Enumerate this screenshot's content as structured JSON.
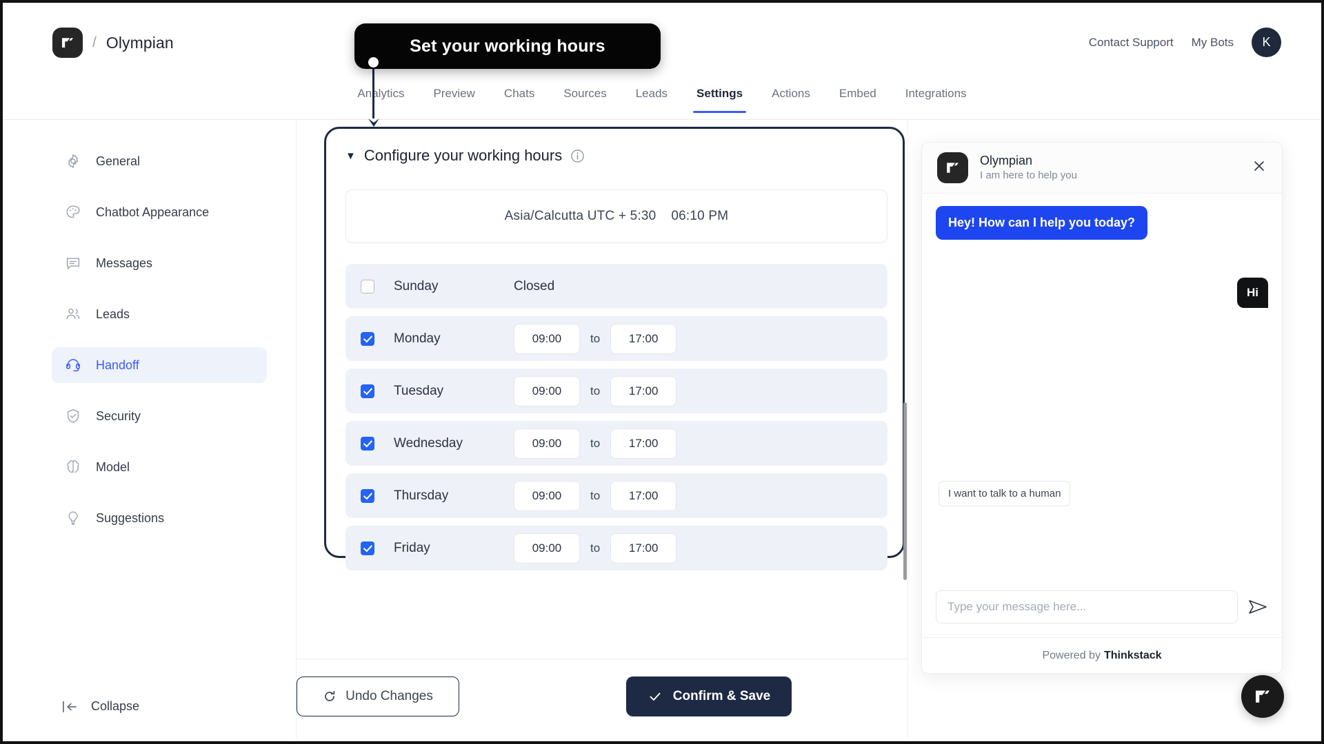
{
  "header": {
    "brand_name": "Olympian",
    "separator": "/",
    "logo_icon": "thinkstack-logo-icon",
    "contact_support": "Contact Support",
    "my_bots": "My Bots",
    "avatar_initial": "K",
    "avatar_color": "#1e293b"
  },
  "tabs": [
    {
      "label": "Analytics",
      "active": false
    },
    {
      "label": "Preview",
      "active": false
    },
    {
      "label": "Chats",
      "active": false
    },
    {
      "label": "Sources",
      "active": false
    },
    {
      "label": "Leads",
      "active": false
    },
    {
      "label": "Settings",
      "active": true
    },
    {
      "label": "Actions",
      "active": false
    },
    {
      "label": "Embed",
      "active": false
    },
    {
      "label": "Integrations",
      "active": false
    }
  ],
  "tab_accent_color": "#3b5bfd",
  "callout": {
    "text": "Set your working hours",
    "background": "#050505",
    "text_color": "#ffffff"
  },
  "sidebar": {
    "items": [
      {
        "label": "General",
        "icon": "gear-icon",
        "active": false
      },
      {
        "label": "Chatbot Appearance",
        "icon": "palette-icon",
        "active": false
      },
      {
        "label": "Messages",
        "icon": "chat-bubble-icon",
        "active": false
      },
      {
        "label": "Leads",
        "icon": "users-icon",
        "active": false
      },
      {
        "label": "Handoff",
        "icon": "headset-icon",
        "active": true
      },
      {
        "label": "Security",
        "icon": "shield-check-icon",
        "active": false
      },
      {
        "label": "Model",
        "icon": "brain-icon",
        "active": false
      },
      {
        "label": "Suggestions",
        "icon": "lightbulb-icon",
        "active": false
      }
    ],
    "active_color": "#3b5bfd",
    "active_bg": "#eef2fb",
    "collapse_label": "Collapse",
    "collapse_icon": "collapse-left-icon"
  },
  "panel": {
    "caret": "▼",
    "title": "Configure your working hours",
    "info_icon": "info-icon",
    "timezone": "Asia/Calcutta UTC + 5:30",
    "current_time": "06:10 PM",
    "to_label": "to",
    "closed_label": "Closed",
    "days": [
      {
        "name": "Sunday",
        "enabled": false,
        "start": "",
        "end": ""
      },
      {
        "name": "Monday",
        "enabled": true,
        "start": "09:00",
        "end": "17:00"
      },
      {
        "name": "Tuesday",
        "enabled": true,
        "start": "09:00",
        "end": "17:00"
      },
      {
        "name": "Wednesday",
        "enabled": true,
        "start": "09:00",
        "end": "17:00"
      },
      {
        "name": "Thursday",
        "enabled": true,
        "start": "09:00",
        "end": "17:00"
      },
      {
        "name": "Friday",
        "enabled": true,
        "start": "09:00",
        "end": "17:00"
      }
    ]
  },
  "actions": {
    "undo_label": "Undo Changes",
    "undo_icon": "refresh-icon",
    "save_label": "Confirm & Save",
    "save_icon": "check-icon",
    "save_bg": "#1e2a44"
  },
  "chat": {
    "title": "Olympian",
    "subtitle": "I am here to help you",
    "logo_icon": "thinkstack-logo-icon",
    "close_icon": "close-icon",
    "bot_message": "Hey! How can I help you today?",
    "bot_bubble_color": "#1e46f0",
    "user_message": "Hi",
    "user_bubble_color": "#111213",
    "quick_reply": "I want to talk to a human",
    "input_placeholder": "Type your message here...",
    "input_value": "",
    "send_icon": "send-icon",
    "footer_prefix": "Powered by",
    "footer_brand": "Thinkstack",
    "fab_icon": "thinkstack-logo-icon"
  }
}
